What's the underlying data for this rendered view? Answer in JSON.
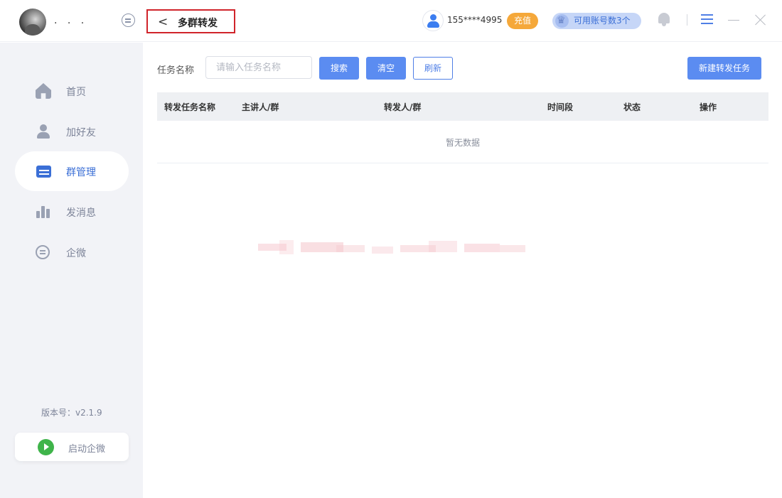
{
  "header": {
    "user_name": ". . .",
    "page_title": "多群转发",
    "back_icon": "<",
    "account_phone": "155****4995",
    "recharge_label": "充值",
    "available_accounts": "可用账号数3个"
  },
  "sidebar": {
    "items": [
      {
        "label": "首页",
        "icon": "home-icon",
        "active": false
      },
      {
        "label": "加好友",
        "icon": "user-icon",
        "active": false
      },
      {
        "label": "群管理",
        "icon": "group-icon",
        "active": true
      },
      {
        "label": "发消息",
        "icon": "message-icon",
        "active": false
      },
      {
        "label": "企微",
        "icon": "wecom-icon",
        "active": false
      }
    ],
    "version": "版本号：v2.1.9",
    "start_wecom_label": "启动企微"
  },
  "filter": {
    "task_name_label": "任务名称",
    "task_name_placeholder": "请输入任务名称",
    "search_label": "搜索",
    "clear_label": "清空",
    "refresh_label": "刷新",
    "new_task_label": "新建转发任务"
  },
  "table": {
    "columns": [
      "转发任务名称",
      "主讲人/群",
      "转发人/群",
      "时间段",
      "状态",
      "操作"
    ],
    "empty_text": "暂无数据"
  },
  "colors": {
    "accent": "#5b8cf1",
    "recharge": "#f5a83a",
    "highlight_box": "#d0242a",
    "sidebar_bg": "#f2f3f7"
  }
}
